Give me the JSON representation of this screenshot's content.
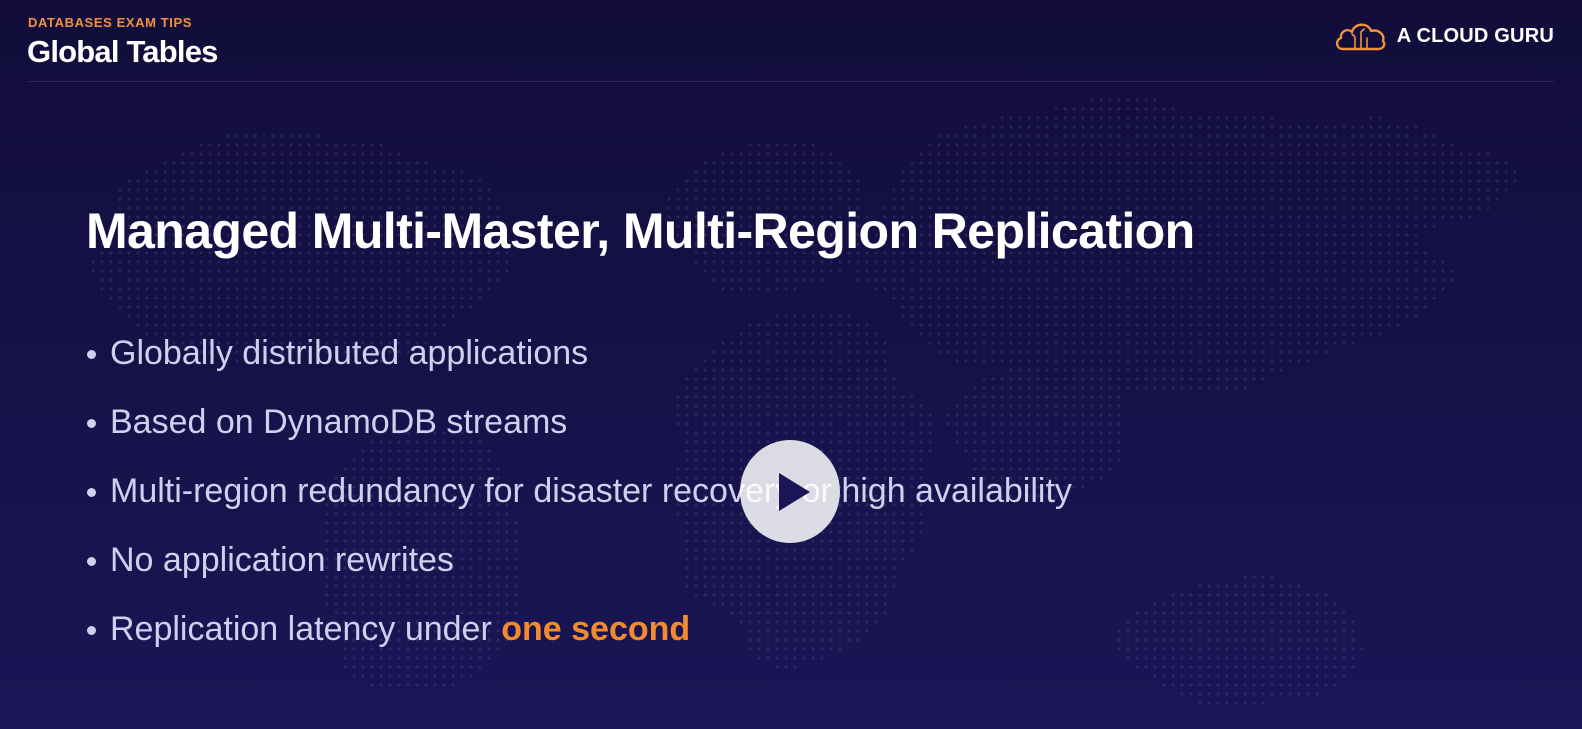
{
  "header": {
    "eyebrow": "DATABASES EXAM TIPS",
    "title": "Global Tables"
  },
  "brand": {
    "name": "A CLOUD GURU",
    "logo_icon": "cloud-logo-icon",
    "logo_color": "#f2913d"
  },
  "content": {
    "heading": "Managed Multi-Master, Multi-Region Replication",
    "bullets": [
      {
        "text": "Globally distributed applications"
      },
      {
        "text": "Based on DynamoDB streams"
      },
      {
        "text": "Multi-region redundancy for disaster recovery or high availability"
      },
      {
        "text": "No application rewrites"
      },
      {
        "text": "Replication latency under ",
        "highlight": "one second"
      }
    ]
  },
  "player": {
    "play_icon": "play-icon"
  },
  "colors": {
    "background": "#16124a",
    "accent": "#f28a2e",
    "body_text": "#d0d0ee"
  }
}
